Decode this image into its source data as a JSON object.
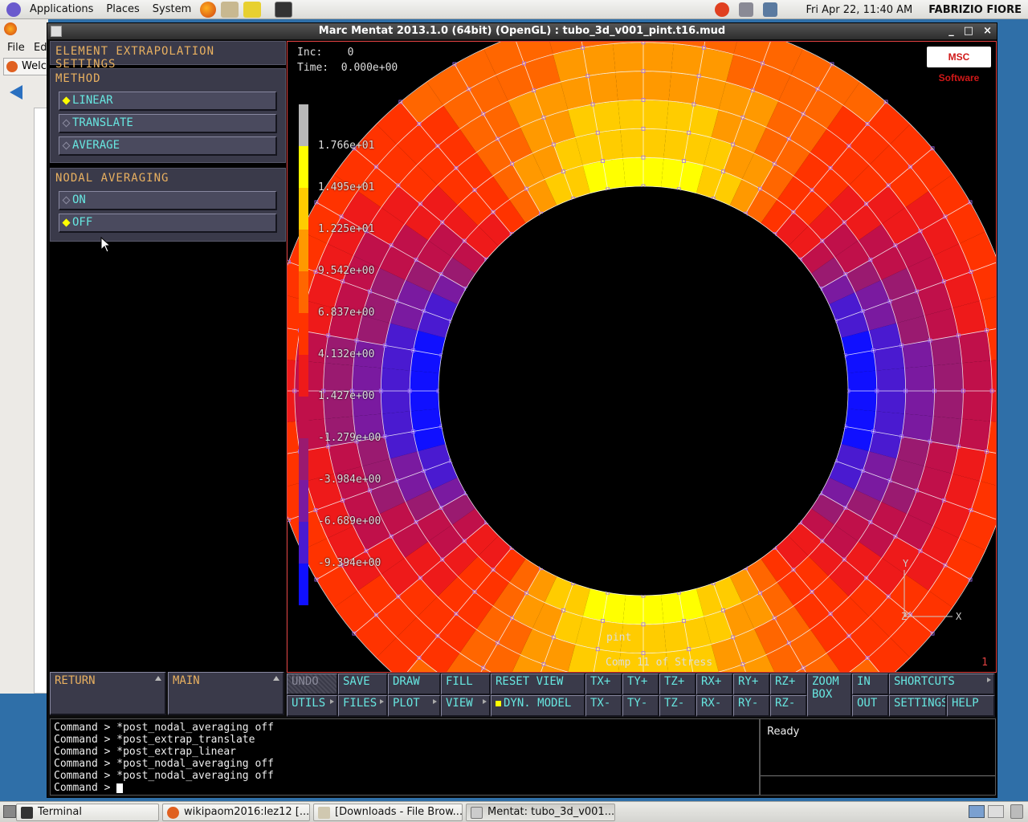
{
  "top_panel": {
    "menus": [
      "Applications",
      "Places",
      "System"
    ],
    "clock": "Fri Apr 22, 11:40 AM",
    "user": "FABRIZIO FIORE"
  },
  "background_window": {
    "menu_file": "File",
    "menu_edit": "Ed",
    "tab_label": "Welc"
  },
  "window": {
    "title": "Marc Mentat 2013.1.0 (64bit) (OpenGL) : tubo_3d_v001_pint.t16.mud",
    "controls": [
      "_",
      "□",
      "×"
    ]
  },
  "left_panel": {
    "header": "ELEMENT EXTRAPOLATION SETTINGS",
    "method": {
      "title": "METHOD",
      "options": [
        {
          "label": "LINEAR",
          "selected": true
        },
        {
          "label": "TRANSLATE",
          "selected": false
        },
        {
          "label": "AVERAGE",
          "selected": false
        }
      ]
    },
    "nodal_averaging": {
      "title": "NODAL AVERAGING",
      "options": [
        {
          "label": "ON",
          "selected": false
        },
        {
          "label": "OFF",
          "selected": true
        }
      ]
    },
    "return_label": "RETURN",
    "main_label": "MAIN"
  },
  "viewport": {
    "inc_label": "Inc:",
    "inc_value": "0",
    "time_label": "Time:",
    "time_value": "0.000e+00",
    "logo": "MSC Software",
    "legend": [
      "1.766e+01",
      "1.495e+01",
      "1.225e+01",
      "9.542e+00",
      "6.837e+00",
      "4.132e+00",
      "1.427e+00",
      "-1.279e+00",
      "-3.984e+00",
      "-6.689e+00",
      "-9.394e+00"
    ],
    "legend_colors": [
      "#ffff00",
      "#ffcc00",
      "#ff9900",
      "#ff6600",
      "#ff3300",
      "#ee1a1a",
      "#c0104a",
      "#9a1a70",
      "#7a1aa0",
      "#4a1ad0",
      "#1010ff"
    ],
    "view_name": "pint",
    "component": "Comp 11 of Stress",
    "frame": "1",
    "axis_x": "X",
    "axis_y": "Y",
    "axis_z": "Z"
  },
  "toolbar": {
    "undo": "UNDO",
    "save": "SAVE",
    "draw": "DRAW",
    "fill": "FILL",
    "reset_view": "RESET VIEW",
    "txp": "TX+",
    "typ": "TY+",
    "tzp": "TZ+",
    "rxp": "RX+",
    "ryp": "RY+",
    "rzp": "RZ+",
    "zoom_box": "ZOOM BOX",
    "in": "IN",
    "shortcuts": "SHORTCUTS",
    "utils": "UTILS",
    "files": "FILES",
    "plot": "PLOT",
    "view": "VIEW",
    "dyn_model": "DYN. MODEL",
    "txm": "TX-",
    "tym": "TY-",
    "tzm": "TZ-",
    "rxm": "RX-",
    "rym": "RY-",
    "rzm": "RZ-",
    "out": "OUT",
    "settings": "SETTINGS",
    "help": "HELP"
  },
  "command_log": [
    "Command > *post_nodal_averaging off",
    "Command > *post_extrap_translate",
    "Command > *post_extrap_linear",
    "Command > *post_nodal_averaging off",
    "Command > *post_nodal_averaging off",
    "Command > "
  ],
  "status": "Ready",
  "taskbar": {
    "tasks": [
      "Terminal",
      "wikipaom2016:lez12 [...",
      "[Downloads - File Brow...",
      "Mentat: tubo_3d_v001..."
    ]
  }
}
